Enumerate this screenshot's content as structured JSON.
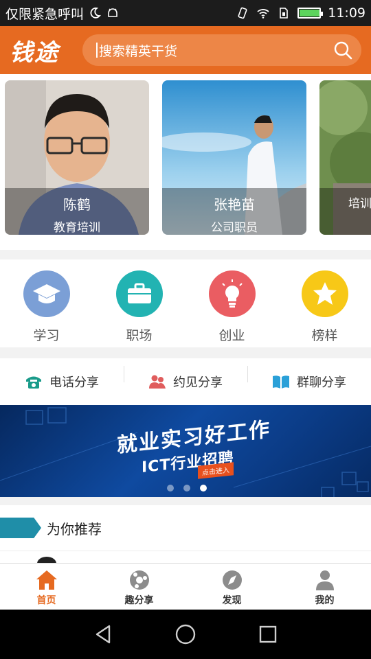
{
  "status_bar": {
    "carrier_text": "仅限紧急呼叫",
    "time": "11:09",
    "battery_level": 0.95
  },
  "header": {
    "logo_text": "钱途",
    "search_placeholder": "搜索精英干货"
  },
  "experts": [
    {
      "name": "陈鹤",
      "role": "教育培训"
    },
    {
      "name": "张艳苗",
      "role": "公司职员"
    },
    {
      "name": "",
      "role": "培训"
    }
  ],
  "categories": [
    {
      "label": "学习",
      "color": "#7b9fd6",
      "icon": "graduation-cap-icon"
    },
    {
      "label": "职场",
      "color": "#22b3b2",
      "icon": "briefcase-icon"
    },
    {
      "label": "创业",
      "color": "#ea5d62",
      "icon": "lightbulb-icon"
    },
    {
      "label": "榜样",
      "color": "#f7c817",
      "icon": "star-icon"
    }
  ],
  "share": [
    {
      "label": "电话分享",
      "icon": "phone-icon",
      "color": "#1a9b8a"
    },
    {
      "label": "约见分享",
      "icon": "people-icon",
      "color": "#e05d5d"
    },
    {
      "label": "群聊分享",
      "icon": "book-icon",
      "color": "#2aa0d8"
    }
  ],
  "banner": {
    "headline": "就业实习好工作",
    "subline": "ICT行业招聘",
    "cta": "点击进入",
    "active_slide": 3,
    "slide_count": 3
  },
  "recommend": {
    "title": "为你推荐"
  },
  "bottom_nav": [
    {
      "label": "首页",
      "icon": "home-icon",
      "active": true
    },
    {
      "label": "趣分享",
      "icon": "share-circle-icon",
      "active": false
    },
    {
      "label": "发现",
      "icon": "compass-icon",
      "active": false
    },
    {
      "label": "我的",
      "icon": "user-icon",
      "active": false
    }
  ],
  "colors": {
    "brand": "#e66a21",
    "accent_recommend": "#1f8ea8"
  }
}
